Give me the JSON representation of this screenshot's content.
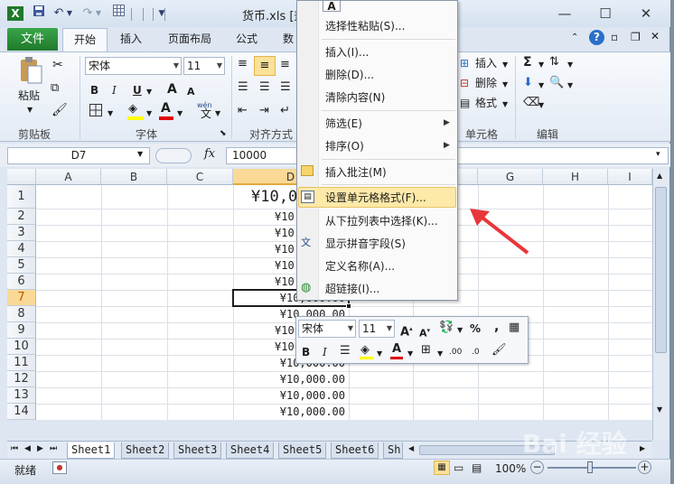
{
  "window": {
    "title": "货币.xls [兼",
    "app_icon": "excel-icon"
  },
  "colors": {
    "file_tab": "#2a8b37",
    "active_cell_header": "#f9d995",
    "menu_highlight": "#fde9a8",
    "annotation_arrow": "#e8373b"
  },
  "ribbon": {
    "tabs": {
      "file": "文件",
      "home": "开始",
      "insert": "插入",
      "page_layout": "页面布局",
      "formulas": "公式",
      "data": "数"
    },
    "clipboard": {
      "paste": "粘贴",
      "group": "剪贴板"
    },
    "font": {
      "name": "宋体",
      "size": "11",
      "group": "字体",
      "bold": "B",
      "italic": "I",
      "underline": "U",
      "grow": "A",
      "shrink": "A",
      "color": "A",
      "wen": "wén",
      "wen_char": "文"
    },
    "alignment": {
      "group": "对齐方式"
    },
    "cells": {
      "insert": "插入",
      "delete": "删除",
      "format": "格式",
      "group": "单元格"
    },
    "editing": {
      "sum": "Σ",
      "group": "编辑"
    }
  },
  "formula_bar": {
    "name_box": "D7",
    "fx": "fx",
    "value": "10000"
  },
  "grid": {
    "columns": [
      "A",
      "B",
      "C",
      "D",
      "E",
      "F",
      "G",
      "H",
      "I"
    ],
    "rows": [
      "1",
      "2",
      "3",
      "4",
      "5",
      "6",
      "7",
      "8",
      "9",
      "10",
      "11",
      "12",
      "13",
      "14"
    ],
    "d_values": [
      "¥10,0",
      "¥10",
      "¥10",
      "¥10",
      "¥10",
      "¥10",
      "¥10,000.00",
      "¥10,000.00",
      "¥10",
      "¥10",
      "¥10,000.00",
      "¥10,000.00",
      "¥10,000.00",
      "¥10,000.00"
    ]
  },
  "sheets": [
    "Sheet1",
    "Sheet2",
    "Sheet3",
    "Sheet4",
    "Sheet5",
    "Sheet6",
    "Sh"
  ],
  "status": {
    "ready": "就绪",
    "zoom": "100%",
    "minus": "−",
    "plus": "+"
  },
  "context_menu": {
    "top_glyph": "A",
    "items": [
      {
        "label": "选择性粘贴(S)..."
      },
      {
        "label": "插入(I)..."
      },
      {
        "label": "删除(D)..."
      },
      {
        "label": "清除内容(N)"
      },
      {
        "label": "筛选(E)"
      },
      {
        "label": "排序(O)"
      },
      {
        "label": "插入批注(M)"
      },
      {
        "label": "设置单元格格式(F)..."
      },
      {
        "label": "从下拉列表中选择(K)..."
      },
      {
        "label": "显示拼音字段(S)"
      },
      {
        "label": "定义名称(A)..."
      },
      {
        "label": "超链接(I)..."
      }
    ]
  },
  "mini_toolbar": {
    "font": "宋体",
    "size": "11",
    "percent": "%",
    "comma": ",",
    "bold": "B",
    "italic": "I",
    "inc_dec": ".00",
    "dec_dec": ".0"
  },
  "watermark": "Bai 经验"
}
